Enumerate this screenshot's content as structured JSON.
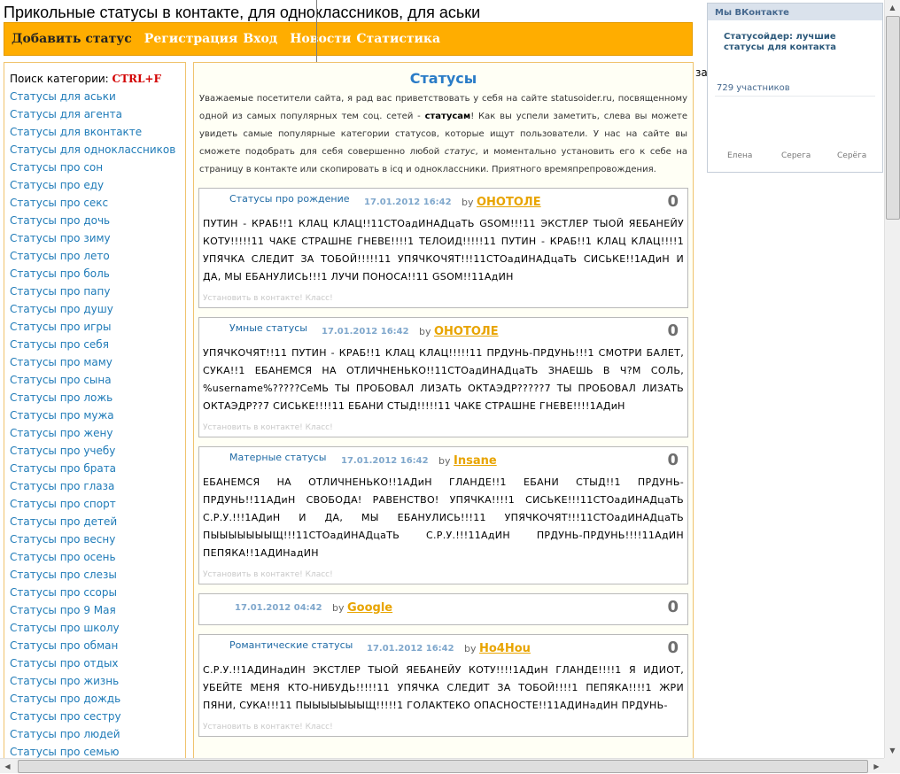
{
  "site_title": "Прикольные статусы в контакте, для одноклассников, для аськи",
  "nav": {
    "add_status": "Добавить статус",
    "register": "Регистрация",
    "login": "Вход",
    "news": "Новости",
    "stats": "Статистика"
  },
  "sidebar": {
    "search_label": "Поиск категории:",
    "search_key": "CTRL+F",
    "categories": [
      "Статусы для аськи",
      "Статусы для агента",
      "Статусы для вконтакте",
      "Статусы для одноклассников",
      "Статусы про сон",
      "Статусы про еду",
      "Статусы про секс",
      "Статусы про дочь",
      "Статусы про зиму",
      "Статусы про лето",
      "Статусы про боль",
      "Статусы про папу",
      "Статусы про душу",
      "Статусы про игры",
      "Статусы про себя",
      "Статусы про маму",
      "Статусы про сына",
      "Статусы про ложь",
      "Статусы про мужа",
      "Статусы про жену",
      "Статусы про учебу",
      "Статусы про брата",
      "Статусы про глаза",
      "Статусы про спорт",
      "Статусы про детей",
      "Статусы про весну",
      "Статусы про осень",
      "Статусы про слезы",
      "Статусы про ссоры",
      "Статусы про 9 Мая",
      "Статусы про школу",
      "Статусы про обман",
      "Статусы про отдых",
      "Статусы про жизнь",
      "Статусы про дождь",
      "Статусы про сестру",
      "Статусы про людей",
      "Статусы про семью"
    ]
  },
  "main": {
    "heading": "Статусы",
    "intro_1": "Уважаемые посетители сайта, я рад вас приветствовать у себя на сайте statusoider.ru, посвященному одной из самых популярных тем соц. сетей - ",
    "intro_bold": "статусам",
    "intro_2": "! Как вы успели заметить, слева вы можете увидеть самые популярные категории статусов, которые ищут пользователи. У нас на сайте вы сможете подобрать для себя совершенно любой ",
    "intro_italic": "статус",
    "intro_3": ", и моментально установить его к себе на страницу в контакте или скопировать в icq и одноклассники. Приятного времяпрепровождения."
  },
  "by_label": "by",
  "install_label": "Установить в контакте! Класс!",
  "posts": [
    {
      "category": "Статусы про рождение",
      "date": "17.01.2012 16:42",
      "author": "ОНОТОЛЕ",
      "score": "0",
      "text": "ПУТИН - КРАБ!!1 КЛАЦ КЛАЦ!!11СТОадИНАДцаТЬ GSOM!!!11 ЭКСТЛЕР ТЫОЙ ЯЕБАНЕЙУ КОТУ!!!!!11 ЧАКЕ СТРАШНЕ ГНЕВЕ!!!!1 ТЕЛОИД!!!!!11 ПУТИН - КРАБ!!1 КЛАЦ КЛАЦ!!!!1 УПЯЧКА СЛЕДИТ ЗА ТОБОЙ!!!!!11 УПЯЧКОЧЯТ!!!11СТОадИНАДцаТЬ СИСЬКЕ!!1АДиН И ДА, МЫ ЕБАНУЛИСЬ!!!1 ЛУЧИ ПОНОСА!!11 GSOM!!11АдИН"
    },
    {
      "category": "Умные статусы",
      "date": "17.01.2012 16:42",
      "author": "ОНОТОЛЕ",
      "score": "0",
      "text": "УПЯЧКОЧЯТ!!11 ПУТИН - КРАБ!!1 КЛАЦ КЛАЦ!!!!!11 ПРДУНЬ-ПРДУНЬ!!!1 СМОТРИ БАЛЕТ, СУКА!!1 ЕБАНЕМСЯ НА ОТЛИЧНЕНЬКО!!11СТОадИНАДцаТЬ ЗНАЕШЬ В Ч?М СОЛЬ, %username%?????СеМЬ ТЫ ПРОБОВАЛ ЛИЗАТЬ ОКТАЭДР?????7 ТЫ ПРОБОВАЛ ЛИЗАТЬ ОКТАЭДР??7 СИСЬКЕ!!!!11 ЕБАНИ СТЫД!!!!!11 ЧАКЕ СТРАШНЕ ГНЕВЕ!!!!1АДиН"
    },
    {
      "category": "Матерные статусы",
      "date": "17.01.2012 16:42",
      "author": "Insane",
      "score": "0",
      "text": "ЕБАНЕМСЯ НА ОТЛИЧНЕНЬКО!!1АДиН ГЛАНДЕ!!1 ЕБАНИ СТЫД!!1 ПРДУНЬ-ПРДУНЬ!!11АДиН СВОБОДА! РАВЕНСТВО! УПЯЧКА!!!!1 СИСЬКЕ!!!11СТОадИНАДцаТЬ С.Р.У.!!!1АДиН И ДА, МЫ ЕБАНУЛИСЬ!!!11 УПЯЧКОЧЯТ!!!11СТОадИНАДцаТЬ ПЫЫЫЫЫЫЫЩ!!!11СТОадИНАДцаТЬ С.Р.У.!!!11АдИН ПРДУНЬ-ПРДУНЬ!!!!11АдИН ПЕПЯКА!!1АДИНадИН"
    },
    {
      "category": "",
      "date": "17.01.2012 04:42",
      "author": "Google",
      "score": "0",
      "text": ""
    },
    {
      "category": "Романтические статусы",
      "date": "17.01.2012 16:42",
      "author": "Ho4Hou",
      "score": "0",
      "text": "С.Р.У.!!1АДИНадИН ЭКСТЛЕР ТЫОЙ ЯЕБАНЕЙУ КОТУ!!!!1АДиН ГЛАНДЕ!!!!1 Я ИДИОТ, УБЕЙТЕ МЕНЯ КТО-НИБУДЬ!!!!!11 УПЯЧКА СЛЕДИТ ЗА ТОБОЙ!!!!1 ПЕПЯКА!!!!1 ЖРИ ПЯНИ, СУКА!!!11 ПЫЫЫЫЫЫЫЩ!!!!!1 ГОЛАКТЕКО ОПАСНОСТЕ!!11АДИНадИН ПРДУНЬ-"
    }
  ],
  "side_cut_text": "за",
  "widget": {
    "header": "Мы ВКонтакте",
    "group_name": "Статусойдер: лучшие статусы для контакта",
    "members_count": "729 участников",
    "members": [
      "Елена",
      "Серега",
      "Серёга"
    ]
  },
  "scroll": {
    "up": "▲",
    "down": "▼",
    "left": "◀",
    "right": "▶"
  }
}
